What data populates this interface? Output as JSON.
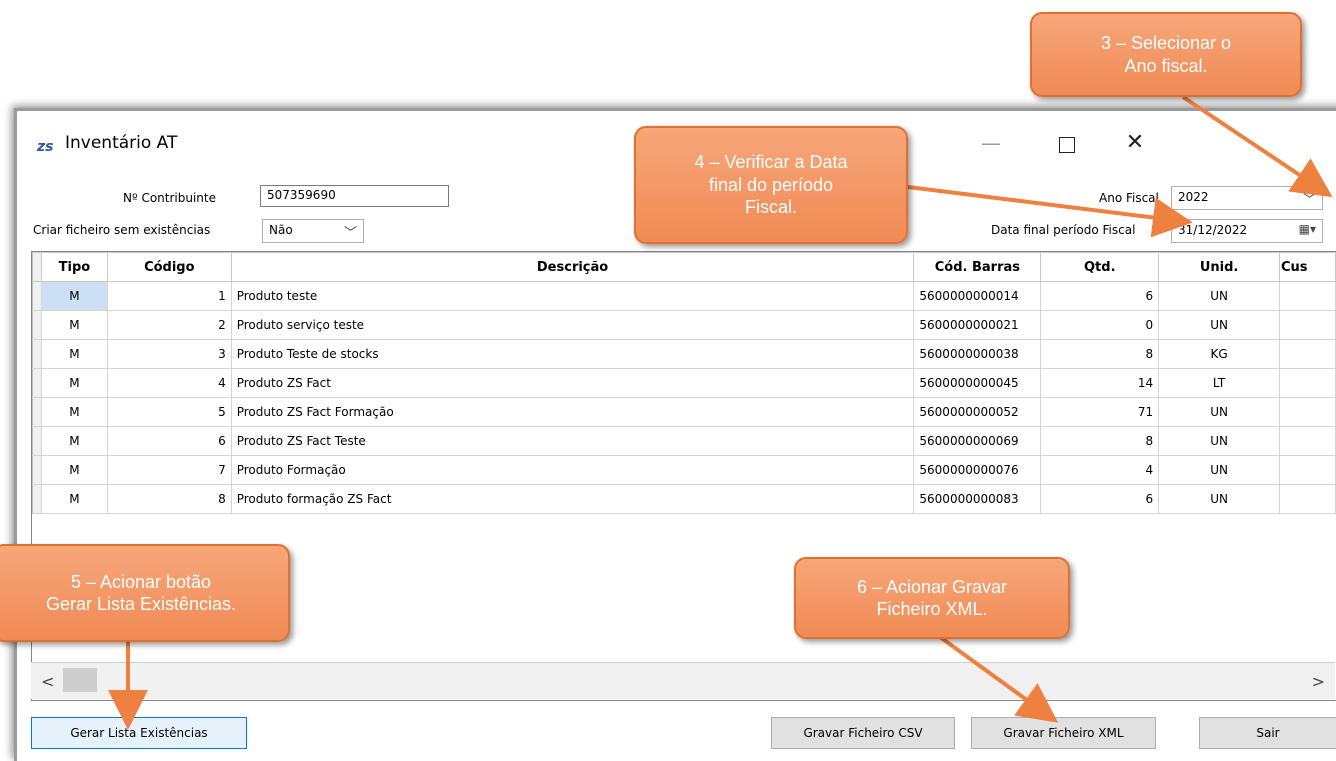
{
  "window": {
    "app_icon": "zs",
    "title": "Inventário AT",
    "minimize_label": "—",
    "close_label": "✕"
  },
  "form": {
    "contribuinte_label": "Nº Contribuinte",
    "contribuinte_value": "507359690",
    "sem_existencias_label": "Criar ficheiro sem existências",
    "sem_existencias_value": "Não",
    "ano_fiscal_label": "Ano Fiscal",
    "ano_fiscal_value": "2022",
    "data_final_label": "Data final período Fiscal",
    "data_final_value": "31/12/2022"
  },
  "table": {
    "headers": [
      "Tipo",
      "Código",
      "Descrição",
      "Cód. Barras",
      "Qtd.",
      "Unid.",
      "Cus"
    ],
    "rows": [
      [
        "M",
        "1",
        "Produto teste",
        "5600000000014",
        "6",
        "UN"
      ],
      [
        "M",
        "2",
        "Produto serviço teste",
        "5600000000021",
        "0",
        "UN"
      ],
      [
        "M",
        "3",
        "Produto Teste de stocks",
        "5600000000038",
        "8",
        "KG"
      ],
      [
        "M",
        "4",
        "Produto ZS Fact",
        "5600000000045",
        "14",
        "LT"
      ],
      [
        "M",
        "5",
        "Produto ZS Fact Formação",
        "5600000000052",
        "71",
        "UN"
      ],
      [
        "M",
        "6",
        "Produto ZS Fact Teste",
        "5600000000069",
        "8",
        "UN"
      ],
      [
        "M",
        "7",
        "Produto Formação",
        "5600000000076",
        "4",
        "UN"
      ],
      [
        "M",
        "8",
        "Produto formação ZS Fact",
        "5600000000083",
        "6",
        "UN"
      ]
    ]
  },
  "buttons": {
    "gerar": "Gerar Lista Existências",
    "csv": "Gravar Ficheiro CSV",
    "xml": "Gravar Ficheiro XML",
    "sair": "Sair"
  },
  "callouts": {
    "c3": "3 – Selecionar o\nAno fiscal.",
    "c4": "4 – Verificar a Data\nfinal do período\nFiscal.",
    "c5": "5 – Acionar botão\nGerar Lista Existências.",
    "c6": "6 – Acionar Gravar\nFicheiro XML."
  },
  "colors": {
    "callout": "#f08a55",
    "arrow": "#ee8040",
    "selection": "#cce0f5"
  }
}
